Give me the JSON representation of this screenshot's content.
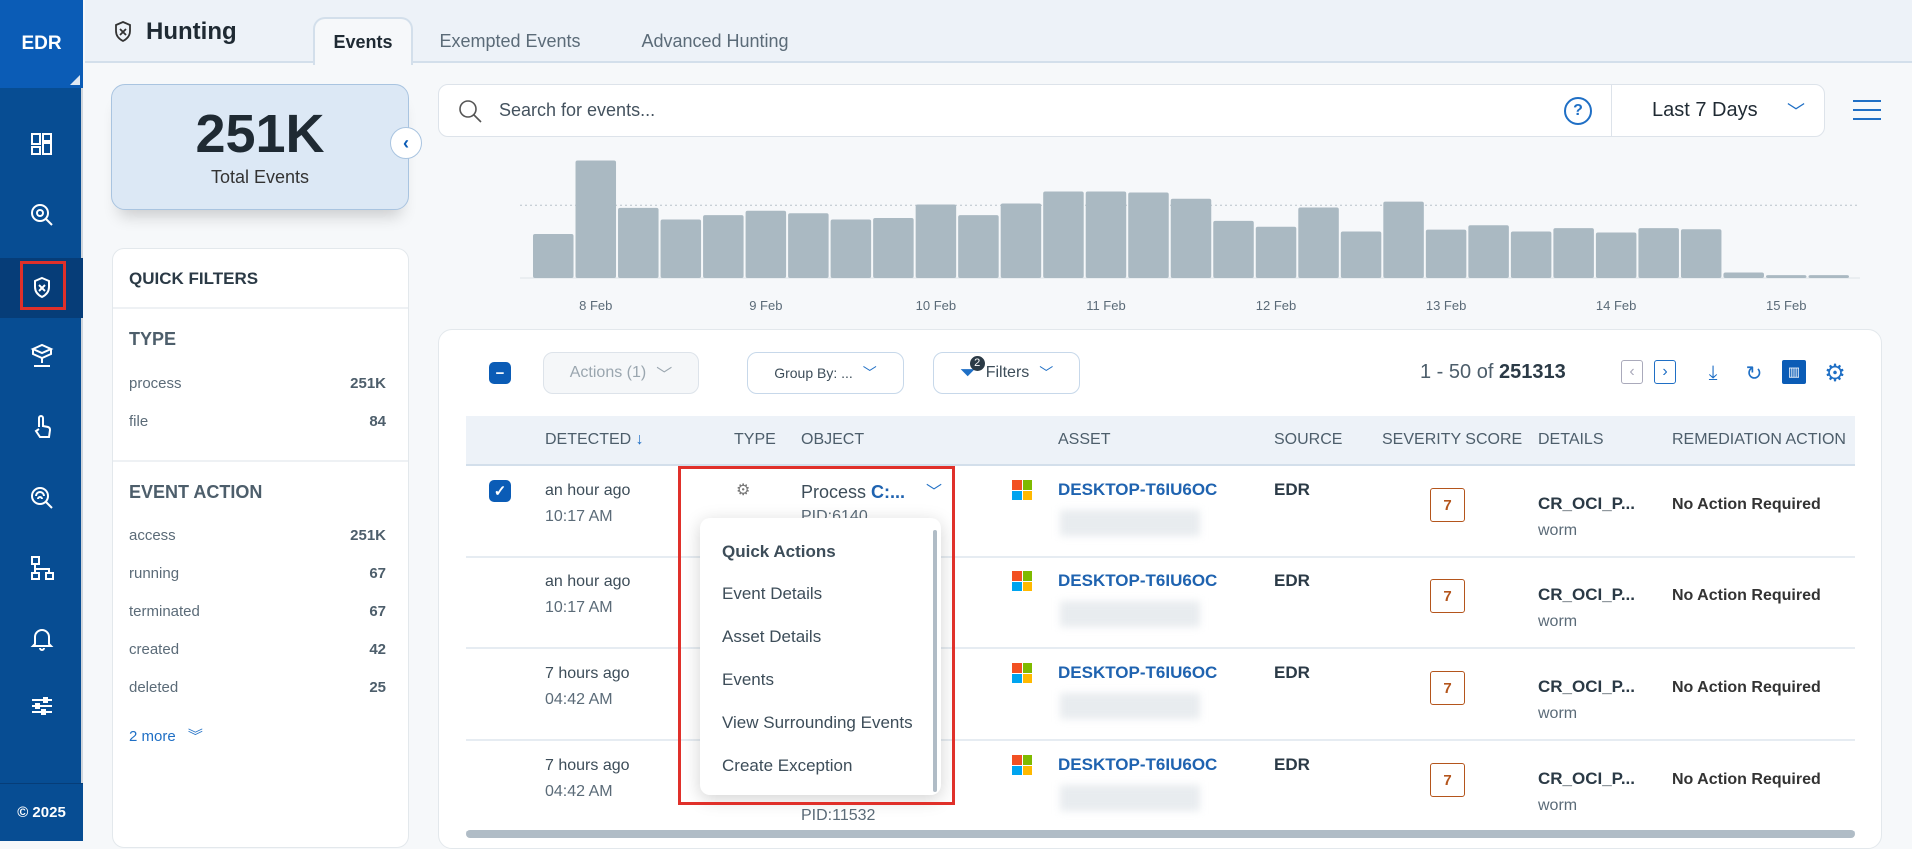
{
  "sidebar": {
    "brand": "EDR",
    "footer": "© 2025",
    "items": [
      "dashboard-icon",
      "threat-search-icon",
      "hunting-icon",
      "network-assets-icon",
      "touch-icon",
      "fingerprint-search-icon",
      "hierarchy-icon",
      "bell-icon",
      "sliders-icon"
    ],
    "active": "hunting-icon"
  },
  "header": {
    "title": "Hunting",
    "tabs": [
      {
        "label": "Events",
        "active": true
      },
      {
        "label": "Exempted Events"
      },
      {
        "label": "Advanced Hunting"
      }
    ]
  },
  "summary": {
    "total": "251K",
    "label": "Total Events"
  },
  "quick_filters": {
    "title": "QUICK FILTERS",
    "type": {
      "title": "TYPE",
      "items": [
        {
          "label": "process",
          "count": "251K"
        },
        {
          "label": "file",
          "count": "84"
        }
      ]
    },
    "event_action": {
      "title": "EVENT ACTION",
      "items": [
        {
          "label": "access",
          "count": "251K"
        },
        {
          "label": "running",
          "count": "67"
        },
        {
          "label": "terminated",
          "count": "67"
        },
        {
          "label": "created",
          "count": "42"
        },
        {
          "label": "deleted",
          "count": "25"
        }
      ],
      "more": "2 more"
    }
  },
  "search": {
    "placeholder": "Search for events...",
    "date_range": "Last 7 Days"
  },
  "chart_data": {
    "type": "bar",
    "x_ticks": [
      "8 Feb",
      "9 Feb",
      "10 Feb",
      "11 Feb",
      "12 Feb",
      "13 Feb",
      "14 Feb",
      "15 Feb"
    ],
    "values": [
      121,
      323,
      193,
      161,
      173,
      185,
      178,
      161,
      165,
      202,
      173,
      205,
      238,
      238,
      235,
      218,
      157,
      141,
      194,
      128,
      210,
      133,
      145,
      128,
      137,
      125,
      137,
      134,
      15,
      8,
      8
    ],
    "reference_line": 200,
    "ylim": [
      0,
      330
    ],
    "grid": false,
    "bar_color": "#aab9c2"
  },
  "toolbar": {
    "actions": "Actions (1)",
    "group_by": "Group By: ...",
    "filters": "Filters",
    "filter_count": "2",
    "range": "1 - 50 of",
    "total": "251313"
  },
  "table": {
    "columns": [
      "DETECTED",
      "TYPE",
      "OBJECT",
      "ASSET",
      "SOURCE",
      "SEVERITY SCORE",
      "DETAILS",
      "REMEDIATION ACTION"
    ],
    "rows": [
      {
        "checked": true,
        "detected": "an hour ago",
        "time": "10:17 AM",
        "object": "Process",
        "object_path": "C:...",
        "pid": "PID:6140",
        "asset": "DESKTOP-T6IU6OC",
        "source": "EDR",
        "severity": "7",
        "details": "CR_OCI_P...",
        "details_sub": "worm",
        "remediation": "No Action Required"
      },
      {
        "checked": false,
        "detected": "an hour ago",
        "time": "10:17 AM",
        "object": "",
        "object_path": "",
        "pid": "",
        "asset": "DESKTOP-T6IU6OC",
        "source": "EDR",
        "severity": "7",
        "details": "CR_OCI_P...",
        "details_sub": "worm",
        "remediation": "No Action Required"
      },
      {
        "checked": false,
        "detected": "7 hours ago",
        "time": "04:42 AM",
        "object": "",
        "object_path": "",
        "pid": "",
        "asset": "DESKTOP-T6IU6OC",
        "source": "EDR",
        "severity": "7",
        "details": "CR_OCI_P...",
        "details_sub": "worm",
        "remediation": "No Action Required"
      },
      {
        "checked": false,
        "detected": "7 hours ago",
        "time": "04:42 AM",
        "object": "",
        "object_path": "",
        "pid": "PID:11532",
        "asset": "DESKTOP-T6IU6OC",
        "source": "EDR",
        "severity": "7",
        "details": "CR_OCI_P...",
        "details_sub": "worm",
        "remediation": "No Action Required"
      }
    ]
  },
  "quick_actions": {
    "title": "Quick Actions",
    "items": [
      "Event Details",
      "Asset Details",
      "Events",
      "View Surrounding Events",
      "Create Exception"
    ]
  },
  "colors": {
    "sidebar": "#074d93",
    "accent": "#1f6fc5",
    "severity": "#b4551c",
    "highlight": "#e0302a"
  }
}
